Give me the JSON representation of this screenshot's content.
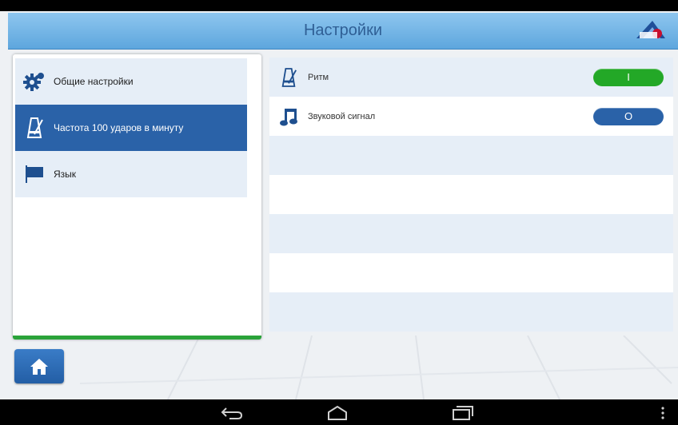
{
  "header": {
    "title": "Настройки"
  },
  "sidebar": {
    "items": [
      {
        "label": "Общие настройки",
        "icon": "gear-icon",
        "selected": false
      },
      {
        "label": "Частота 100 ударов в минуту",
        "icon": "metronome-icon",
        "selected": true
      },
      {
        "label": "Язык",
        "icon": "flag-icon",
        "selected": false
      }
    ]
  },
  "settings": {
    "rows": [
      {
        "label": "Ритм",
        "icon": "metronome-icon",
        "toggle_text": "I",
        "state": "on"
      },
      {
        "label": "Звуковой сигнал",
        "icon": "music-note-icon",
        "toggle_text": "O",
        "state": "off"
      }
    ]
  },
  "colors": {
    "accent_blue": "#2a62a8",
    "toggle_on": "#23a827",
    "header_blue": "#6fb2e5",
    "panel_stripe": "#e6eef7"
  },
  "icons": {
    "home": "home-icon",
    "nav_back": "back-icon",
    "nav_home": "nav-home-icon",
    "nav_recent": "recent-apps-icon",
    "overflow": "overflow-menu-icon",
    "logo": "brand-logo"
  }
}
